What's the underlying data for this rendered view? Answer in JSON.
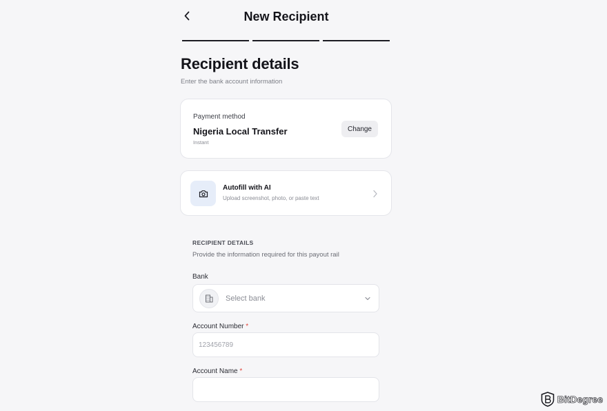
{
  "header": {
    "title": "New Recipient",
    "back_icon": "chevron-left-icon"
  },
  "steps": [
    {
      "state": "active"
    },
    {
      "state": "active"
    },
    {
      "state": "active"
    }
  ],
  "section": {
    "title": "Recipient details",
    "subtitle": "Enter the bank account information"
  },
  "payment_method": {
    "label": "Payment method",
    "value": "Nigeria Local Transfer",
    "speed": "Instant",
    "change_label": "Change"
  },
  "autofill": {
    "title": "Autofill with AI",
    "subtitle": "Upload screenshot, photo, or paste text",
    "icon": "camera-icon",
    "chevron_icon": "chevron-right-icon"
  },
  "recipient_details": {
    "header": "RECIPIENT DETAILS",
    "subtitle": "Provide the information required for this payout rail"
  },
  "fields": {
    "bank": {
      "label": "Bank",
      "placeholder": "Select bank",
      "icon": "bank-icon",
      "chevron_icon": "chevron-down-icon"
    },
    "account_number": {
      "label": "Account Number",
      "required_mark": "*",
      "placeholder": "123456789",
      "value": ""
    },
    "account_name": {
      "label": "Account Name",
      "required_mark": "*",
      "placeholder": "",
      "value": ""
    }
  },
  "watermark": {
    "text": "BitDegree",
    "icon": "bitdegree-logo-icon"
  },
  "colors": {
    "accent": "#1b1b22",
    "required": "#e0463d",
    "ai_icon_bg": "#e6edf9",
    "background": "#f6f6f8"
  }
}
